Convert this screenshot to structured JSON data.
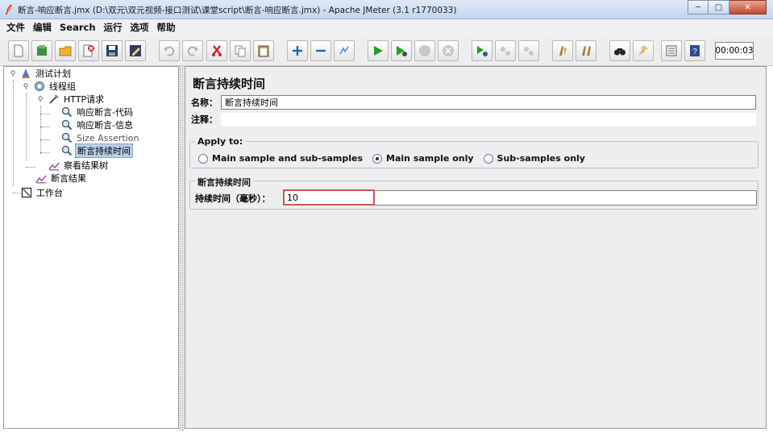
{
  "window": {
    "title": "断言-响应断言.jmx (D:\\双元\\双元视频-接口测试\\课堂script\\断言-响应断言.jmx) - Apache JMeter (3.1 r1770033)",
    "minimize_glyph": "─",
    "maximize_glyph": "□",
    "close_glyph": "✕"
  },
  "menu": {
    "items": [
      "文件",
      "编辑",
      "Search",
      "运行",
      "选项",
      "帮助"
    ]
  },
  "toolbar": {
    "buttons": [
      "new-icon",
      "templates-icon",
      "open-icon",
      "close-icon",
      "save-icon",
      "save-as-icon",
      "undo-icon",
      "redo-icon",
      "cut-icon",
      "copy-icon",
      "paste-icon",
      "expand-icon",
      "collapse-icon",
      "toggle-icon",
      "start-icon",
      "start-no-pause-icon",
      "stop-icon",
      "shutdown-icon",
      "remote-start-icon",
      "remote-stop-icon",
      "remote-shutdown-icon",
      "clear-icon",
      "clear-all-icon",
      "search-icon",
      "reset-search-icon",
      "function-helper-icon",
      "help-icon"
    ],
    "timer": "00:00:03"
  },
  "tree": {
    "nodes": [
      {
        "label": "测试计划",
        "icon": "test-plan-icon"
      },
      {
        "label": "线程组",
        "icon": "thread-group-icon"
      },
      {
        "label": "HTTP请求",
        "icon": "sampler-icon"
      },
      {
        "label": "响应断言-代码",
        "icon": "assertion-icon"
      },
      {
        "label": "响应断言-信息",
        "icon": "assertion-icon"
      },
      {
        "label": "Size Assertion",
        "icon": "assertion-icon"
      },
      {
        "label": "断言持续时间",
        "icon": "assertion-icon"
      },
      {
        "label": "察看结果树",
        "icon": "listener-icon"
      },
      {
        "label": "断言结果",
        "icon": "listener-icon"
      },
      {
        "label": "工作台",
        "icon": "workbench-icon"
      }
    ]
  },
  "panel": {
    "title": "断言持续时间",
    "name_label": "名称：",
    "name_value": "断言持续时间",
    "comment_label": "注释：",
    "comment_value": "",
    "apply_to": {
      "title": "Apply to:",
      "options": [
        "Main sample and sub-samples",
        "Main sample only",
        "Sub-samples only"
      ],
      "selected": "Main sample only"
    },
    "duration": {
      "group_title": "断言持续时间",
      "label": "持续时间（毫秒）：",
      "value": "10"
    }
  }
}
